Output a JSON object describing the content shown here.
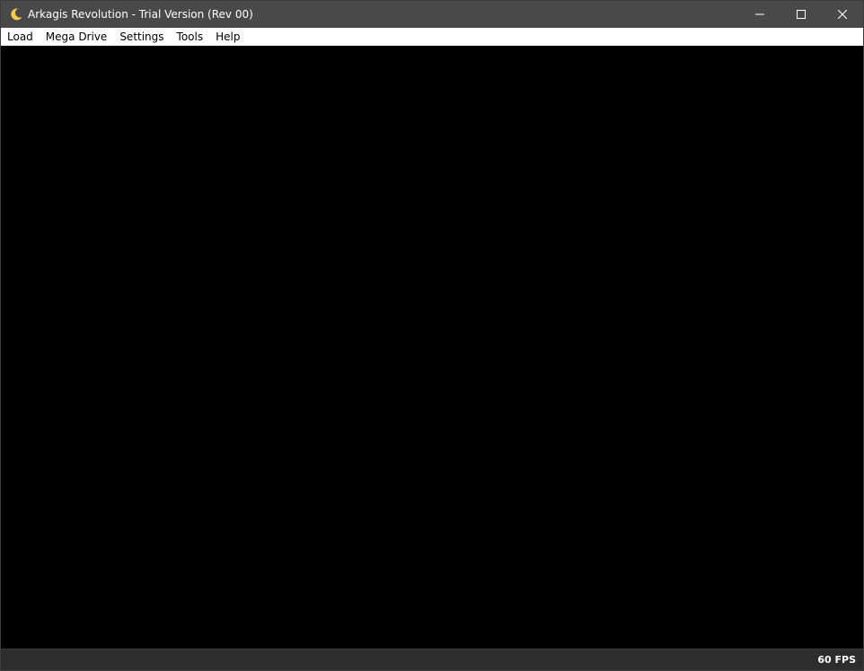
{
  "window": {
    "title": "Arkagis Revolution - Trial Version (Rev 00)",
    "icon": "crescent-moon-icon",
    "accent_color": "#f2c94c",
    "titlebar_color": "#494949"
  },
  "menu": {
    "items": [
      {
        "label": "Load"
      },
      {
        "label": "Mega Drive"
      },
      {
        "label": "Settings"
      },
      {
        "label": "Tools"
      },
      {
        "label": "Help"
      }
    ]
  },
  "status": {
    "fps": "60 FPS"
  }
}
